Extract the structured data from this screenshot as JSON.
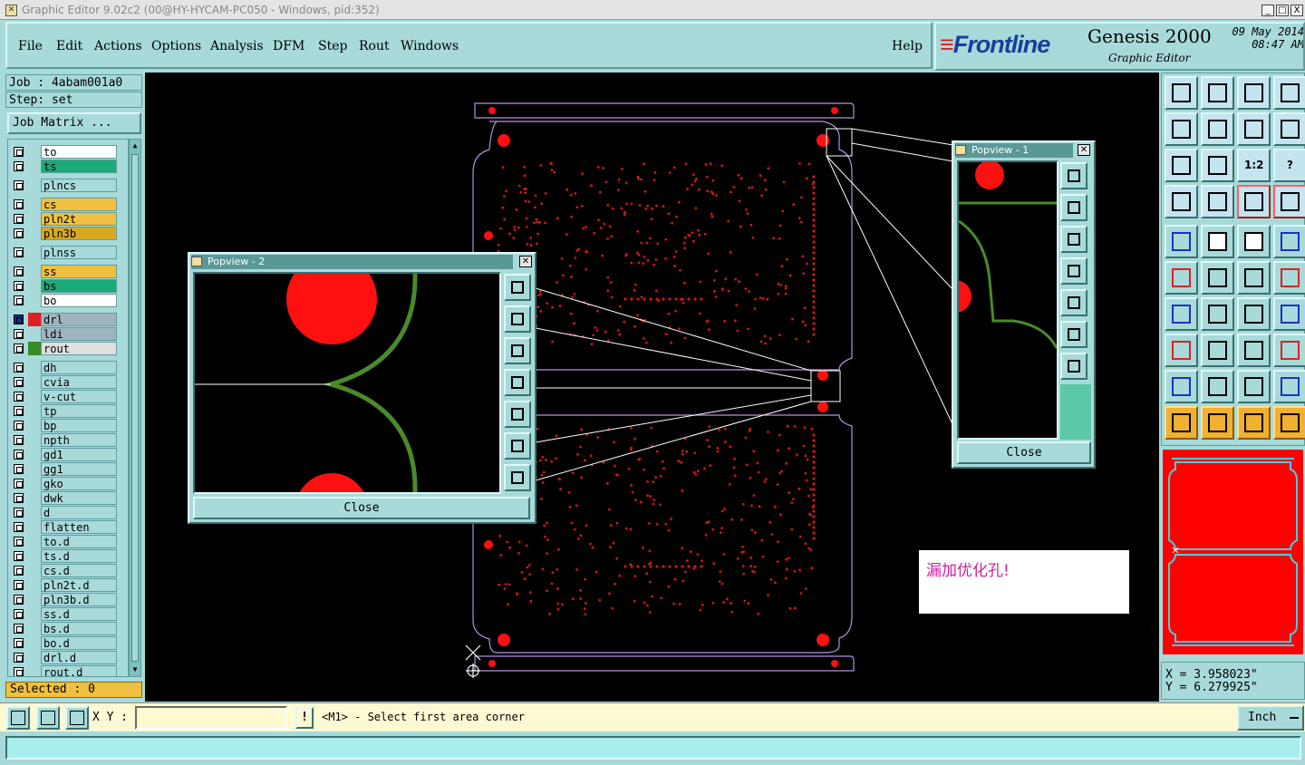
{
  "window": {
    "title": "Graphic Editor 9.02c2 (00@HY-HYCAM-PC050 - Windows, pid:352)",
    "controls": [
      "_",
      "□",
      "X"
    ]
  },
  "menu": {
    "items": [
      "File",
      "Edit",
      "Actions",
      "Options",
      "Analysis",
      "DFM",
      "Step",
      "Rout",
      "Windows"
    ],
    "help": "Help"
  },
  "brand": {
    "logo": "Frontline",
    "product": "Genesis 2000",
    "subtitle": "Graphic Editor",
    "date": "09 May 2014",
    "time": "08:47 AM"
  },
  "job": {
    "job_label": "Job : 4abam001a0",
    "step_label": "Step: set",
    "matrix_button": "Job Matrix ..."
  },
  "layers": [
    {
      "name": "to",
      "color": "#ffffff"
    },
    {
      "name": "ts",
      "color": "#1aaa7a"
    },
    {
      "name": "plncs",
      "color": "#a8dada"
    },
    {
      "name": "cs",
      "color": "#f0c040"
    },
    {
      "name": "pln2t",
      "color": "#f0c040"
    },
    {
      "name": "pln3b",
      "color": "#d8a820"
    },
    {
      "name": "plnss",
      "color": "#a8dada"
    },
    {
      "name": "ss",
      "color": "#f0c040"
    },
    {
      "name": "bs",
      "color": "#1aaa7a"
    },
    {
      "name": "bo",
      "color": "#ffffff"
    },
    {
      "name": "drl",
      "color": "#a0b4c0",
      "swatch": "#e02020",
      "active": true
    },
    {
      "name": "ldi",
      "color": "#a0b4c0"
    },
    {
      "name": "rout",
      "color": "#e0e0e0",
      "swatch": "#3a8a2a"
    },
    {
      "name": "dh",
      "color": "#a8dada"
    },
    {
      "name": "cvia",
      "color": "#a8dada"
    },
    {
      "name": "v-cut",
      "color": "#a8dada"
    },
    {
      "name": "tp",
      "color": "#a8dada"
    },
    {
      "name": "bp",
      "color": "#a8dada"
    },
    {
      "name": "npth",
      "color": "#a8dada"
    },
    {
      "name": "gd1",
      "color": "#a8dada"
    },
    {
      "name": "gg1",
      "color": "#a8dada"
    },
    {
      "name": "gko",
      "color": "#a8dada"
    },
    {
      "name": "dwk",
      "color": "#a8dada"
    },
    {
      "name": "d",
      "color": "#a8dada"
    },
    {
      "name": "flatten",
      "color": "#a8dada"
    },
    {
      "name": "to.d",
      "color": "#a8dada"
    },
    {
      "name": "ts.d",
      "color": "#a8dada"
    },
    {
      "name": "cs.d",
      "color": "#a8dada"
    },
    {
      "name": "pln2t.d",
      "color": "#a8dada"
    },
    {
      "name": "pln3b.d",
      "color": "#a8dada"
    },
    {
      "name": "ss.d",
      "color": "#a8dada"
    },
    {
      "name": "bs.d",
      "color": "#a8dada"
    },
    {
      "name": "bo.d",
      "color": "#a8dada"
    },
    {
      "name": "drl.d",
      "color": "#a8dada"
    },
    {
      "name": "rout.d",
      "color": "#a8dada"
    }
  ],
  "selected": "Selected : 0",
  "popview2": {
    "title": "Popview - 2",
    "close": "Close"
  },
  "popview1": {
    "title": "Popview - 1",
    "close": "Close"
  },
  "note": "漏加优化孔!",
  "coords": {
    "x": "X = 3.958023\"",
    "y": "Y = 6.279925\""
  },
  "bottom": {
    "xy_label": "X Y :",
    "xy_value": "",
    "bang": "!",
    "prompt": "<M1> - Select first area corner",
    "unit": "Inch"
  },
  "status": ""
}
